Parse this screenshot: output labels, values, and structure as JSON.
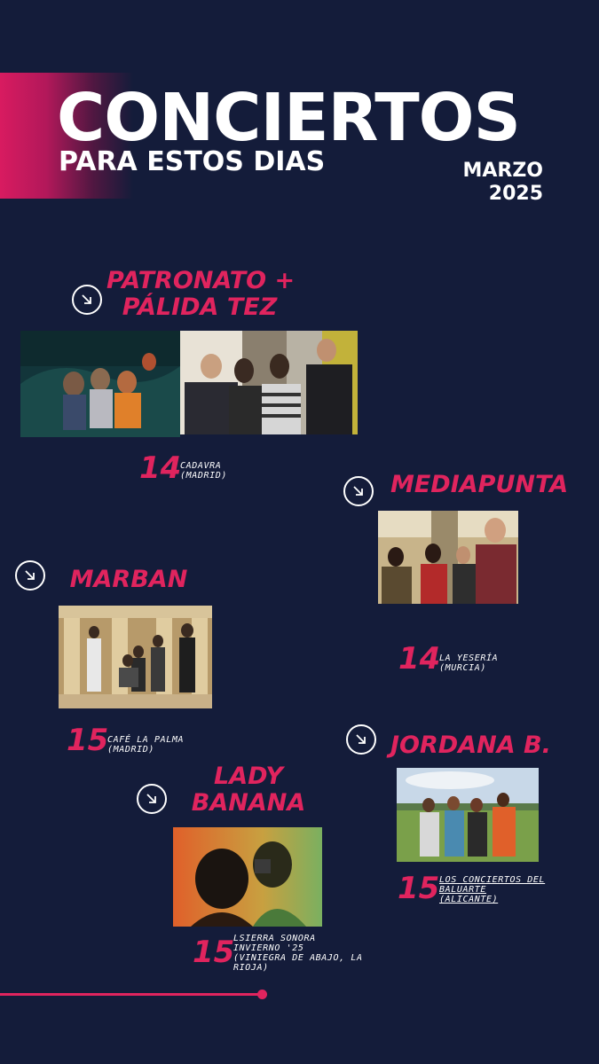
{
  "header": {
    "title": "CONCIERTOS",
    "subtitle": "PARA ESTOS DIAS",
    "month": "MARZO",
    "year": "2025"
  },
  "colors": {
    "background": "#141c3a",
    "accent": "#e0245e",
    "text": "#ffffff"
  },
  "icons": {
    "arrow": "arrow-down-right-icon"
  },
  "concerts": [
    {
      "band_line1": "PATRONATO +",
      "band_line2": "PÁLIDA TEZ",
      "day": "14",
      "venue_line1": "CADAVRA",
      "venue_line2": "(MADRID)"
    },
    {
      "band_line1": "MEDIAPUNTA",
      "day": "14",
      "venue_line1": "LA YESERÍA",
      "venue_line2": "(MURCIA)"
    },
    {
      "band_line1": "MARBAN",
      "day": "15",
      "venue_line1": "CAFÉ LA PALMA",
      "venue_line2": "(MADRID)"
    },
    {
      "band_line1": "JORDANA B.",
      "day": "15",
      "venue_line1": "LOS CONCIERTOS DEL",
      "venue_line2": "BALUARTE",
      "venue_line3": "(ALICANTE)"
    },
    {
      "band_line1": "LADY",
      "band_line2": "BANANA",
      "day": "15",
      "venue_line1": "LSIERRA SONORA",
      "venue_line2": "INVIERNO '25",
      "venue_line3": "(VINIEGRA DE ABAJO, LA",
      "venue_line4": "RIOJA)"
    }
  ]
}
